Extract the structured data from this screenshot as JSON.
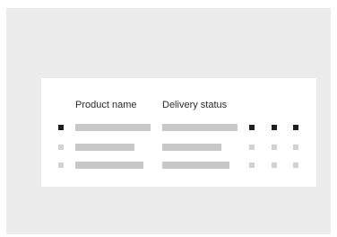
{
  "table": {
    "columns": {
      "product_name": "Product name",
      "delivery_status": "Delivery status"
    },
    "rows": [
      {
        "selected": true,
        "product_fill": 1.0,
        "status_fill": 1.0
      },
      {
        "selected": false,
        "product_fill": 0.78,
        "status_fill": 0.78
      },
      {
        "selected": false,
        "product_fill": 0.9,
        "status_fill": 0.89
      }
    ]
  },
  "colors": {
    "canvas": "#ececec",
    "card": "#ffffff",
    "placeholder_bar": "#c8c8c8",
    "selected_marker": "#1e1e1e",
    "unselected_marker": "#d2d2d2",
    "text": "#2b2b2b"
  }
}
